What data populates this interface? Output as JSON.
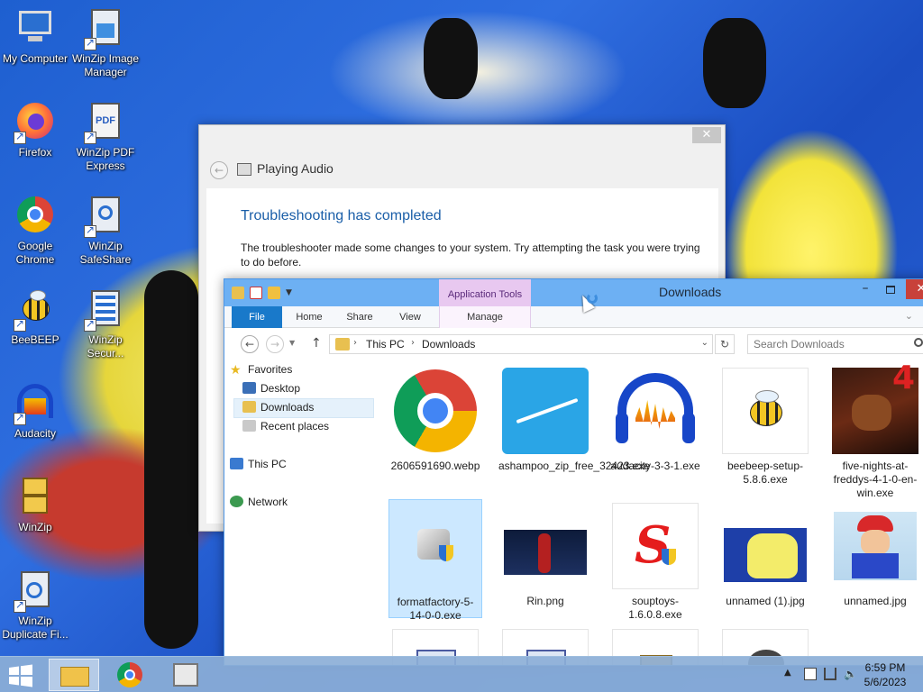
{
  "desktop": {
    "icons": [
      {
        "label": "My Computer"
      },
      {
        "label": "WinZip Image Manager"
      },
      {
        "label": "Firefox"
      },
      {
        "label": "WinZip PDF Express"
      },
      {
        "label": "Google Chrome"
      },
      {
        "label": "WinZip SafeShare"
      },
      {
        "label": "BeeBEEP"
      },
      {
        "label": "WinZip Secur..."
      },
      {
        "label": "Audacity"
      },
      {
        "label": "WinZip"
      },
      {
        "label": "WinZip Duplicate Fi..."
      }
    ]
  },
  "troubleshooter": {
    "title": "Playing Audio",
    "close": "✕",
    "back": "←",
    "heading": "Troubleshooting has completed",
    "body": "The troubleshooter made some changes to your system. Try attempting the task you were trying to do before."
  },
  "explorer": {
    "title": "Downloads",
    "app_tools": "Application Tools",
    "tabs": [
      "File",
      "Home",
      "Share",
      "View",
      "Manage"
    ],
    "minimize": "–",
    "close": "✕",
    "address": {
      "this_pc": "This PC",
      "downloads": "Downloads",
      "separator": "›"
    },
    "search_placeholder": "Search Downloads",
    "nav": {
      "favorites": "Favorites",
      "desktop": "Desktop",
      "downloads": "Downloads",
      "recent": "Recent places",
      "this_pc": "This PC",
      "network": "Network"
    },
    "files": [
      {
        "name": "2606591690.webp"
      },
      {
        "name": "ashampoo_zip_free_32423.exe"
      },
      {
        "name": "audacity-3-3-1.exe"
      },
      {
        "name": "beebeep-setup-5.8.6.exe"
      },
      {
        "name": "five-nights-at-freddys-4-1-0-en-win.exe"
      },
      {
        "name": "formatfactory-5-14-0-0.exe"
      },
      {
        "name": "Rin.png"
      },
      {
        "name": "souptoys-1.6.0.8.exe"
      },
      {
        "name": "unnamed (1).jpg"
      },
      {
        "name": "unnamed.jpg"
      }
    ]
  },
  "taskbar": {
    "time": "6:59 PM",
    "date": "5/6/2023"
  },
  "colors": {
    "accent": "#1979ca",
    "titlebar": "#6db0f3",
    "app_tools": "#e8c8f0",
    "close_red": "#c8413a",
    "heading_blue": "#1a5ea8"
  }
}
